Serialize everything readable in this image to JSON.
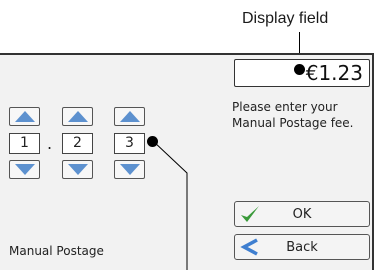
{
  "annotations": {
    "display_field_label": "Display field"
  },
  "display": {
    "value": "€1.23"
  },
  "instruction": {
    "text": "Please enter your Manual Postage fee."
  },
  "digits": {
    "values": [
      "1",
      "2",
      "3"
    ],
    "decimal_separator": "."
  },
  "buttons": {
    "ok_label": "OK",
    "back_label": "Back"
  },
  "screen": {
    "title": "Manual Postage"
  },
  "icons": {
    "ok": "checkmark-icon",
    "back": "back-arrow-icon",
    "up": "triangle-up-icon",
    "down": "triangle-down-icon"
  },
  "colors": {
    "arrow_blue": "#5d91cf",
    "check_green": "#3a9a3a",
    "back_blue": "#3f7fd0",
    "panel_bg": "#f2f2f2"
  }
}
